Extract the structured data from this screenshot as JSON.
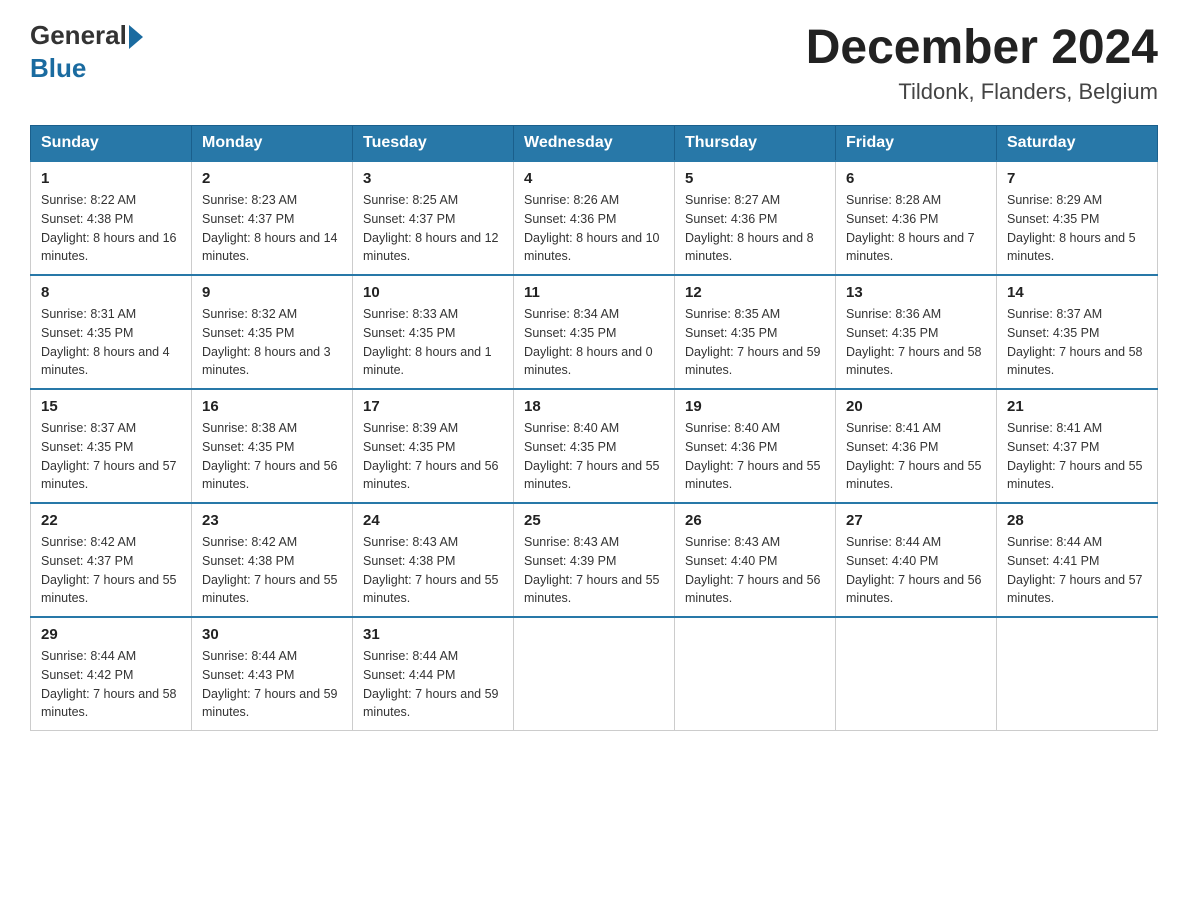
{
  "logo": {
    "text_general": "General",
    "text_blue": "Blue"
  },
  "title": {
    "month_year": "December 2024",
    "location": "Tildonk, Flanders, Belgium"
  },
  "days_of_week": [
    "Sunday",
    "Monday",
    "Tuesday",
    "Wednesday",
    "Thursday",
    "Friday",
    "Saturday"
  ],
  "weeks": [
    [
      {
        "day": "1",
        "sunrise": "8:22 AM",
        "sunset": "4:38 PM",
        "daylight": "8 hours and 16 minutes."
      },
      {
        "day": "2",
        "sunrise": "8:23 AM",
        "sunset": "4:37 PM",
        "daylight": "8 hours and 14 minutes."
      },
      {
        "day": "3",
        "sunrise": "8:25 AM",
        "sunset": "4:37 PM",
        "daylight": "8 hours and 12 minutes."
      },
      {
        "day": "4",
        "sunrise": "8:26 AM",
        "sunset": "4:36 PM",
        "daylight": "8 hours and 10 minutes."
      },
      {
        "day": "5",
        "sunrise": "8:27 AM",
        "sunset": "4:36 PM",
        "daylight": "8 hours and 8 minutes."
      },
      {
        "day": "6",
        "sunrise": "8:28 AM",
        "sunset": "4:36 PM",
        "daylight": "8 hours and 7 minutes."
      },
      {
        "day": "7",
        "sunrise": "8:29 AM",
        "sunset": "4:35 PM",
        "daylight": "8 hours and 5 minutes."
      }
    ],
    [
      {
        "day": "8",
        "sunrise": "8:31 AM",
        "sunset": "4:35 PM",
        "daylight": "8 hours and 4 minutes."
      },
      {
        "day": "9",
        "sunrise": "8:32 AM",
        "sunset": "4:35 PM",
        "daylight": "8 hours and 3 minutes."
      },
      {
        "day": "10",
        "sunrise": "8:33 AM",
        "sunset": "4:35 PM",
        "daylight": "8 hours and 1 minute."
      },
      {
        "day": "11",
        "sunrise": "8:34 AM",
        "sunset": "4:35 PM",
        "daylight": "8 hours and 0 minutes."
      },
      {
        "day": "12",
        "sunrise": "8:35 AM",
        "sunset": "4:35 PM",
        "daylight": "7 hours and 59 minutes."
      },
      {
        "day": "13",
        "sunrise": "8:36 AM",
        "sunset": "4:35 PM",
        "daylight": "7 hours and 58 minutes."
      },
      {
        "day": "14",
        "sunrise": "8:37 AM",
        "sunset": "4:35 PM",
        "daylight": "7 hours and 58 minutes."
      }
    ],
    [
      {
        "day": "15",
        "sunrise": "8:37 AM",
        "sunset": "4:35 PM",
        "daylight": "7 hours and 57 minutes."
      },
      {
        "day": "16",
        "sunrise": "8:38 AM",
        "sunset": "4:35 PM",
        "daylight": "7 hours and 56 minutes."
      },
      {
        "day": "17",
        "sunrise": "8:39 AM",
        "sunset": "4:35 PM",
        "daylight": "7 hours and 56 minutes."
      },
      {
        "day": "18",
        "sunrise": "8:40 AM",
        "sunset": "4:35 PM",
        "daylight": "7 hours and 55 minutes."
      },
      {
        "day": "19",
        "sunrise": "8:40 AM",
        "sunset": "4:36 PM",
        "daylight": "7 hours and 55 minutes."
      },
      {
        "day": "20",
        "sunrise": "8:41 AM",
        "sunset": "4:36 PM",
        "daylight": "7 hours and 55 minutes."
      },
      {
        "day": "21",
        "sunrise": "8:41 AM",
        "sunset": "4:37 PM",
        "daylight": "7 hours and 55 minutes."
      }
    ],
    [
      {
        "day": "22",
        "sunrise": "8:42 AM",
        "sunset": "4:37 PM",
        "daylight": "7 hours and 55 minutes."
      },
      {
        "day": "23",
        "sunrise": "8:42 AM",
        "sunset": "4:38 PM",
        "daylight": "7 hours and 55 minutes."
      },
      {
        "day": "24",
        "sunrise": "8:43 AM",
        "sunset": "4:38 PM",
        "daylight": "7 hours and 55 minutes."
      },
      {
        "day": "25",
        "sunrise": "8:43 AM",
        "sunset": "4:39 PM",
        "daylight": "7 hours and 55 minutes."
      },
      {
        "day": "26",
        "sunrise": "8:43 AM",
        "sunset": "4:40 PM",
        "daylight": "7 hours and 56 minutes."
      },
      {
        "day": "27",
        "sunrise": "8:44 AM",
        "sunset": "4:40 PM",
        "daylight": "7 hours and 56 minutes."
      },
      {
        "day": "28",
        "sunrise": "8:44 AM",
        "sunset": "4:41 PM",
        "daylight": "7 hours and 57 minutes."
      }
    ],
    [
      {
        "day": "29",
        "sunrise": "8:44 AM",
        "sunset": "4:42 PM",
        "daylight": "7 hours and 58 minutes."
      },
      {
        "day": "30",
        "sunrise": "8:44 AM",
        "sunset": "4:43 PM",
        "daylight": "7 hours and 59 minutes."
      },
      {
        "day": "31",
        "sunrise": "8:44 AM",
        "sunset": "4:44 PM",
        "daylight": "7 hours and 59 minutes."
      },
      null,
      null,
      null,
      null
    ]
  ],
  "labels": {
    "sunrise": "Sunrise:",
    "sunset": "Sunset:",
    "daylight": "Daylight:"
  }
}
